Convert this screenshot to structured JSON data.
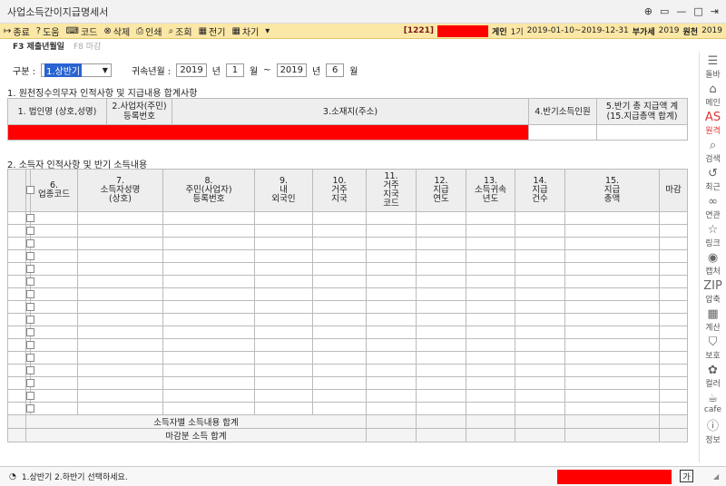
{
  "window": {
    "title": "사업소득간이지급명세서",
    "controls": [
      "⊕",
      "▭",
      "—",
      "□",
      "⇥"
    ]
  },
  "toolbar": {
    "buttons": [
      {
        "icon": "↦",
        "label": "종료"
      },
      {
        "icon": "?",
        "label": "도움"
      },
      {
        "icon": "⌨",
        "label": "코드"
      },
      {
        "icon": "⊗",
        "label": "삭제"
      },
      {
        "icon": "⎙",
        "label": "인쇄"
      },
      {
        "icon": "⌕",
        "label": "조회"
      },
      {
        "icon": "▦",
        "label": "전기"
      },
      {
        "icon": "▦",
        "label": "차기"
      },
      {
        "icon": "▾",
        "label": ""
      }
    ],
    "company_code": "[1221]",
    "company_suffix": "게인",
    "period_label": "1기",
    "period_range": "2019-01-10~2019-12-31",
    "vat_label": "부가세",
    "vat_year": "2019",
    "withholding_label": "원천",
    "withholding_year": "2019"
  },
  "subbar": {
    "f3": "F3 제출년월일",
    "f8": "F8 마감"
  },
  "filters": {
    "gubun_label": "구분 :",
    "gubun_value": "1.상반기",
    "period_label": "귀속년월 :",
    "from_year": "2019",
    "year_unit": "년",
    "from_month": "1",
    "month_unit": "월",
    "separator": "~",
    "to_year": "2019",
    "to_month": "6"
  },
  "section1": {
    "title": "1. 원천징수의무자 인적사항 및 지급내용 합계사항",
    "headers": [
      "1. 법인명 (상호,성명)",
      "2.사업자(주민)\n등록번호",
      "3.소재지(주소)",
      "4.반기소득인원",
      "5.반기 총 지급액 계\n(15.지급총액 합계)"
    ]
  },
  "section2": {
    "title": "2. 소득자 인적사항 및 반기 소득내용",
    "headers": [
      "6.\n업종코드",
      "7.\n소득자성명\n(상호)",
      "8.\n주민(사업자)\n등록번호",
      "9.\n내\n외국인",
      "10.\n거주\n지국",
      "11.\n거주\n지국\n코드",
      "12.\n지급\n연도",
      "13.\n소득귀속\n년도",
      "14.\n지급\n건수",
      "15.\n지급\n총액",
      "마감"
    ],
    "row_count": 16,
    "summary_rows": [
      "소득자별 소득내용 합계",
      "마감분 소득 합계"
    ]
  },
  "sidebar": [
    {
      "icon": "☰",
      "label": "돌바"
    },
    {
      "icon": "⌂",
      "label": "메인"
    },
    {
      "icon": "AS",
      "label": "원격",
      "active": true
    },
    {
      "icon": "⌕",
      "label": "검색"
    },
    {
      "icon": "↺",
      "label": "최근"
    },
    {
      "icon": "∞",
      "label": "연관"
    },
    {
      "icon": "☆",
      "label": "링크"
    },
    {
      "icon": "◉",
      "label": "캡처"
    },
    {
      "icon": "ZIP",
      "label": "압축"
    },
    {
      "icon": "▦",
      "label": "계산"
    },
    {
      "icon": "⛉",
      "label": "보호"
    },
    {
      "icon": "✿",
      "label": "컬러"
    },
    {
      "icon": "☕",
      "label": "cafe"
    },
    {
      "icon": "ⓘ",
      "label": "정보"
    }
  ],
  "status": {
    "icon": "◔",
    "message": "1.상반기 2.하반기 선택하세요.",
    "lang": "가"
  },
  "colors": {
    "redaction": "#ff0000",
    "toolbar_bg": "#fbe7a6",
    "select_highlight": "#2a63d0"
  }
}
